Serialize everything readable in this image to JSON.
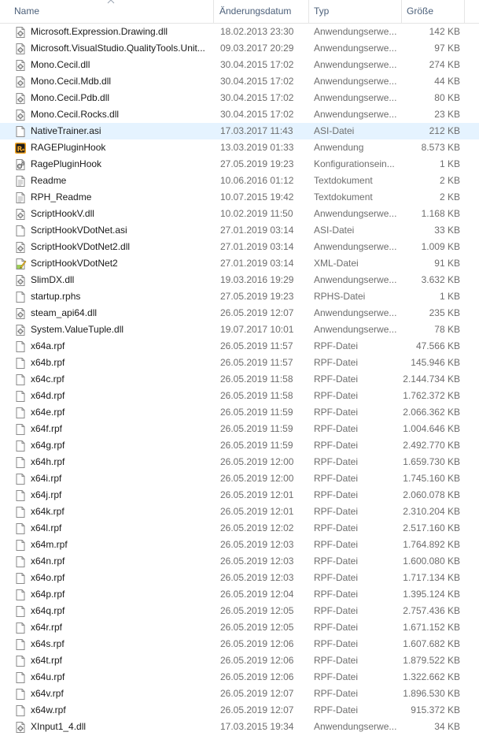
{
  "columns": {
    "name": "Name",
    "date": "Änderungsdatum",
    "type": "Typ",
    "size": "Größe"
  },
  "files": [
    {
      "name": "Microsoft.Expression.Drawing.dll",
      "date": "18.02.2013 23:30",
      "type": "Anwendungserwe...",
      "size": "142 KB",
      "icon": "dll-icon"
    },
    {
      "name": "Microsoft.VisualStudio.QualityTools.Unit...",
      "date": "09.03.2017 20:29",
      "type": "Anwendungserwe...",
      "size": "97 KB",
      "icon": "dll-icon"
    },
    {
      "name": "Mono.Cecil.dll",
      "date": "30.04.2015 17:02",
      "type": "Anwendungserwe...",
      "size": "274 KB",
      "icon": "dll-icon"
    },
    {
      "name": "Mono.Cecil.Mdb.dll",
      "date": "30.04.2015 17:02",
      "type": "Anwendungserwe...",
      "size": "44 KB",
      "icon": "dll-icon"
    },
    {
      "name": "Mono.Cecil.Pdb.dll",
      "date": "30.04.2015 17:02",
      "type": "Anwendungserwe...",
      "size": "80 KB",
      "icon": "dll-icon"
    },
    {
      "name": "Mono.Cecil.Rocks.dll",
      "date": "30.04.2015 17:02",
      "type": "Anwendungserwe...",
      "size": "23 KB",
      "icon": "dll-icon"
    },
    {
      "name": "NativeTrainer.asi",
      "date": "17.03.2017 11:43",
      "type": "ASI-Datei",
      "size": "212 KB",
      "icon": "file-icon",
      "selected": true
    },
    {
      "name": "RAGEPluginHook",
      "date": "13.03.2019 01:33",
      "type": "Anwendung",
      "size": "8.573 KB",
      "icon": "rockstar-app-icon"
    },
    {
      "name": "RagePluginHook",
      "date": "27.05.2019 19:23",
      "type": "Konfigurationsein...",
      "size": "1 KB",
      "icon": "config-file-icon"
    },
    {
      "name": "Readme",
      "date": "10.06.2016 01:12",
      "type": "Textdokument",
      "size": "2 KB",
      "icon": "text-file-icon"
    },
    {
      "name": "RPH_Readme",
      "date": "10.07.2015 19:42",
      "type": "Textdokument",
      "size": "2 KB",
      "icon": "text-file-icon"
    },
    {
      "name": "ScriptHookV.dll",
      "date": "10.02.2019 11:50",
      "type": "Anwendungserwe...",
      "size": "1.168 KB",
      "icon": "dll-icon"
    },
    {
      "name": "ScriptHookVDotNet.asi",
      "date": "27.01.2019 03:14",
      "type": "ASI-Datei",
      "size": "33 KB",
      "icon": "file-icon"
    },
    {
      "name": "ScriptHookVDotNet2.dll",
      "date": "27.01.2019 03:14",
      "type": "Anwendungserwe...",
      "size": "1.009 KB",
      "icon": "dll-icon"
    },
    {
      "name": "ScriptHookVDotNet2",
      "date": "27.01.2019 03:14",
      "type": "XML-Datei",
      "size": "91 KB",
      "icon": "xml-file-icon"
    },
    {
      "name": "SlimDX.dll",
      "date": "19.03.2016 19:29",
      "type": "Anwendungserwe...",
      "size": "3.632 KB",
      "icon": "dll-icon"
    },
    {
      "name": "startup.rphs",
      "date": "27.05.2019 19:23",
      "type": "RPHS-Datei",
      "size": "1 KB",
      "icon": "file-icon"
    },
    {
      "name": "steam_api64.dll",
      "date": "26.05.2019 12:07",
      "type": "Anwendungserwe...",
      "size": "235 KB",
      "icon": "dll-icon"
    },
    {
      "name": "System.ValueTuple.dll",
      "date": "19.07.2017 10:01",
      "type": "Anwendungserwe...",
      "size": "78 KB",
      "icon": "dll-icon"
    },
    {
      "name": "x64a.rpf",
      "date": "26.05.2019 11:57",
      "type": "RPF-Datei",
      "size": "47.566 KB",
      "icon": "file-icon"
    },
    {
      "name": "x64b.rpf",
      "date": "26.05.2019 11:57",
      "type": "RPF-Datei",
      "size": "145.946 KB",
      "icon": "file-icon"
    },
    {
      "name": "x64c.rpf",
      "date": "26.05.2019 11:58",
      "type": "RPF-Datei",
      "size": "2.144.734 KB",
      "icon": "file-icon"
    },
    {
      "name": "x64d.rpf",
      "date": "26.05.2019 11:58",
      "type": "RPF-Datei",
      "size": "1.762.372 KB",
      "icon": "file-icon"
    },
    {
      "name": "x64e.rpf",
      "date": "26.05.2019 11:59",
      "type": "RPF-Datei",
      "size": "2.066.362 KB",
      "icon": "file-icon"
    },
    {
      "name": "x64f.rpf",
      "date": "26.05.2019 11:59",
      "type": "RPF-Datei",
      "size": "1.004.646 KB",
      "icon": "file-icon"
    },
    {
      "name": "x64g.rpf",
      "date": "26.05.2019 11:59",
      "type": "RPF-Datei",
      "size": "2.492.770 KB",
      "icon": "file-icon"
    },
    {
      "name": "x64h.rpf",
      "date": "26.05.2019 12:00",
      "type": "RPF-Datei",
      "size": "1.659.730 KB",
      "icon": "file-icon"
    },
    {
      "name": "x64i.rpf",
      "date": "26.05.2019 12:00",
      "type": "RPF-Datei",
      "size": "1.745.160 KB",
      "icon": "file-icon"
    },
    {
      "name": "x64j.rpf",
      "date": "26.05.2019 12:01",
      "type": "RPF-Datei",
      "size": "2.060.078 KB",
      "icon": "file-icon"
    },
    {
      "name": "x64k.rpf",
      "date": "26.05.2019 12:01",
      "type": "RPF-Datei",
      "size": "2.310.204 KB",
      "icon": "file-icon"
    },
    {
      "name": "x64l.rpf",
      "date": "26.05.2019 12:02",
      "type": "RPF-Datei",
      "size": "2.517.160 KB",
      "icon": "file-icon"
    },
    {
      "name": "x64m.rpf",
      "date": "26.05.2019 12:03",
      "type": "RPF-Datei",
      "size": "1.764.892 KB",
      "icon": "file-icon"
    },
    {
      "name": "x64n.rpf",
      "date": "26.05.2019 12:03",
      "type": "RPF-Datei",
      "size": "1.600.080 KB",
      "icon": "file-icon"
    },
    {
      "name": "x64o.rpf",
      "date": "26.05.2019 12:03",
      "type": "RPF-Datei",
      "size": "1.717.134 KB",
      "icon": "file-icon"
    },
    {
      "name": "x64p.rpf",
      "date": "26.05.2019 12:04",
      "type": "RPF-Datei",
      "size": "1.395.124 KB",
      "icon": "file-icon"
    },
    {
      "name": "x64q.rpf",
      "date": "26.05.2019 12:05",
      "type": "RPF-Datei",
      "size": "2.757.436 KB",
      "icon": "file-icon"
    },
    {
      "name": "x64r.rpf",
      "date": "26.05.2019 12:05",
      "type": "RPF-Datei",
      "size": "1.671.152 KB",
      "icon": "file-icon"
    },
    {
      "name": "x64s.rpf",
      "date": "26.05.2019 12:06",
      "type": "RPF-Datei",
      "size": "1.607.682 KB",
      "icon": "file-icon"
    },
    {
      "name": "x64t.rpf",
      "date": "26.05.2019 12:06",
      "type": "RPF-Datei",
      "size": "1.879.522 KB",
      "icon": "file-icon"
    },
    {
      "name": "x64u.rpf",
      "date": "26.05.2019 12:06",
      "type": "RPF-Datei",
      "size": "1.322.662 KB",
      "icon": "file-icon"
    },
    {
      "name": "x64v.rpf",
      "date": "26.05.2019 12:07",
      "type": "RPF-Datei",
      "size": "1.896.530 KB",
      "icon": "file-icon"
    },
    {
      "name": "x64w.rpf",
      "date": "26.05.2019 12:07",
      "type": "RPF-Datei",
      "size": "915.372 KB",
      "icon": "file-icon"
    },
    {
      "name": "XInput1_4.dll",
      "date": "17.03.2015 19:34",
      "type": "Anwendungserwe...",
      "size": "34 KB",
      "icon": "dll-icon"
    }
  ],
  "colors": {
    "header_text": "#4c607a",
    "selected_row": "#e5f3ff",
    "secondary_text": "#6d6d6d"
  }
}
